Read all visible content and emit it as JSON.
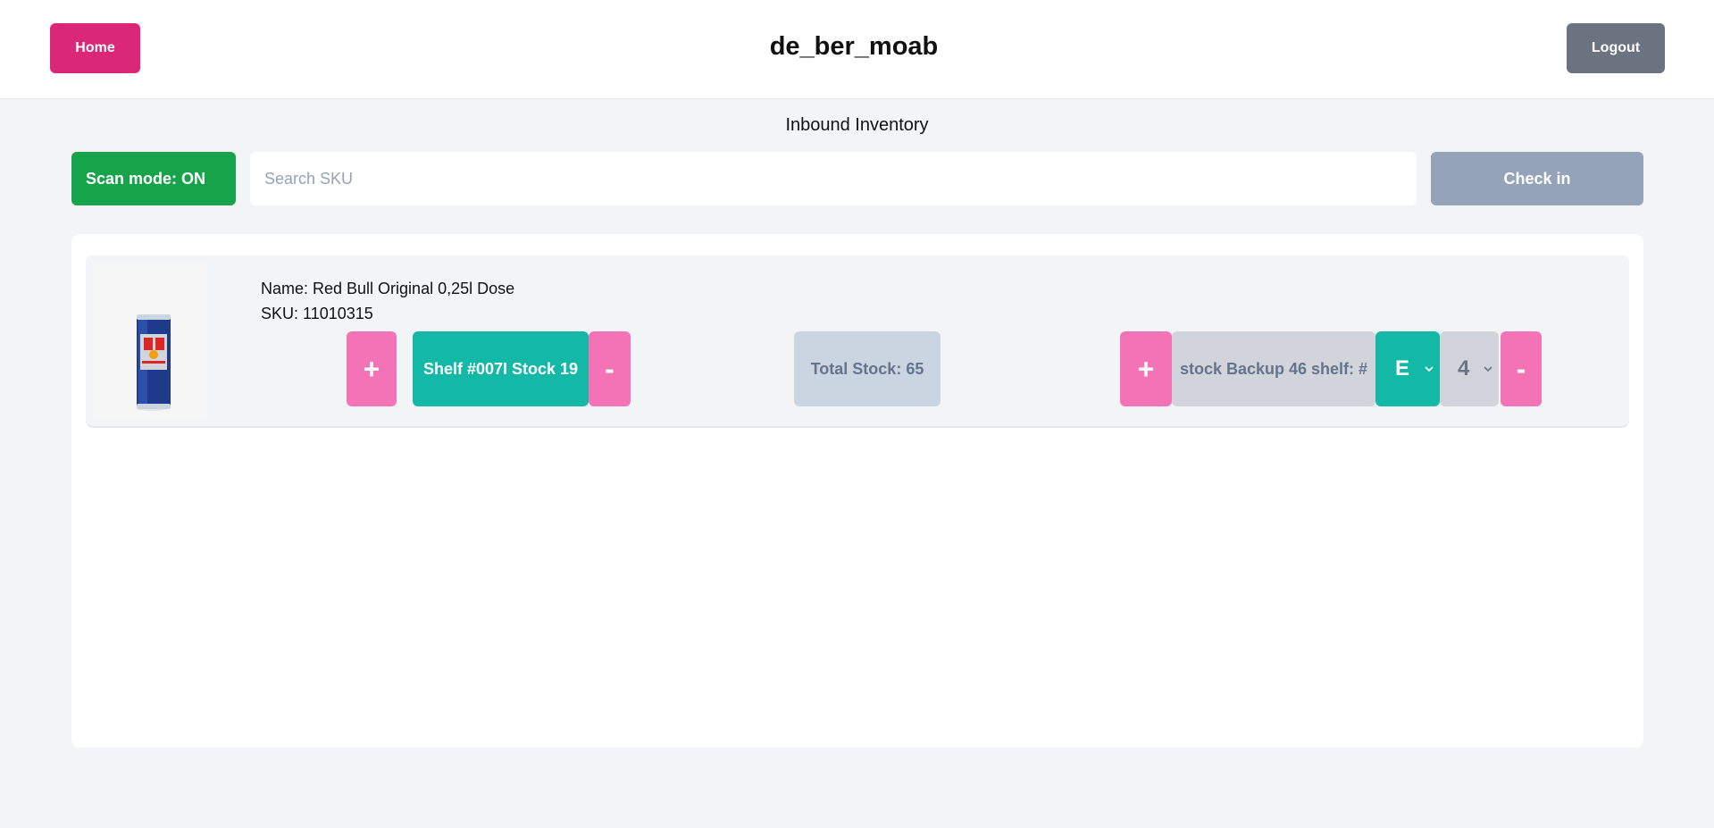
{
  "header": {
    "home_label": "Home",
    "title": "de_ber_moab",
    "logout_label": "Logout"
  },
  "page": {
    "heading": "Inbound Inventory"
  },
  "toolbar": {
    "scan_mode_label": "Scan mode: ON",
    "search_placeholder": "Search SKU",
    "search_value": "",
    "checkin_label": "Check in"
  },
  "items": [
    {
      "image_icon": "red-bull-can",
      "name": "Name: Red Bull Original 0,25l Dose",
      "sku": "SKU: 11010315",
      "shelf_plus": "+",
      "shelf_label": "Shelf #007I Stock 19",
      "shelf_minus": "-",
      "total_stock": "Total Stock: 65",
      "backup_plus": "+",
      "backup_label": "stock Backup 46 shelf: #",
      "backup_letter": "E",
      "backup_number": "4",
      "backup_minus": "-"
    }
  ],
  "colors": {
    "home": "#db2777",
    "logout": "#6b7280",
    "scan_on": "#16a34a",
    "checkin_disabled": "#94a3b8",
    "pink_action": "#f472b6",
    "teal": "#14b8a6"
  }
}
